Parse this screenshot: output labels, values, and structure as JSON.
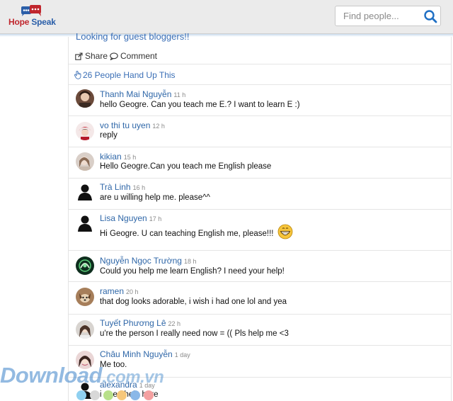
{
  "header": {
    "logo": {
      "hope": "Hope",
      "speak": "Speak"
    },
    "search": {
      "placeholder": "Find people..."
    }
  },
  "post": {
    "clipped_title": "Looking for guest bloggers!!",
    "actions": {
      "share": "Share",
      "comment": "Comment"
    },
    "hand_up": "26 People Hand Up This"
  },
  "comments": [
    {
      "author": "Thanh Mai Nguyễn",
      "time": "11 h",
      "text": "hello Geogre. Can you teach me E.? I want to learn E :)",
      "avatar": "photo-dark"
    },
    {
      "author": "vo thi tu uyen",
      "time": "12 h",
      "text": "reply",
      "avatar": "photo-red"
    },
    {
      "author": "kikian",
      "time": "15 h",
      "text": "Hello Geogre.Can you teach me English please",
      "avatar": "photo-light"
    },
    {
      "author": "Trà Linh",
      "time": "16 h",
      "text": "are u willing help me. please^^",
      "avatar": "silhouette"
    },
    {
      "author": "Lisa Nguyen",
      "time": "17 h",
      "text": "Hi Geogre. U can teaching English me, please!!!",
      "avatar": "silhouette",
      "emoji": "grin-emoji"
    },
    {
      "author": "Nguyễn Ngọc Trường",
      "time": "18 h",
      "text": "Could you help me learn English? I need your help!",
      "avatar": "photo-green"
    },
    {
      "author": "ramen",
      "time": "20 h",
      "text": "that dog looks adorable, i wish i had one lol and yea",
      "avatar": "photo-dog"
    },
    {
      "author": "Tuyết Phương Lê",
      "time": "22 h",
      "text": "u're the person I really need now = (( Pls help me <3",
      "avatar": "photo-girl"
    },
    {
      "author": "Châu Minh Nguyễn",
      "time": "1 day",
      "text": "Me too.",
      "avatar": "photo-pink"
    },
    {
      "author": "alexandra",
      "time": "1 day",
      "text": "i need help here",
      "avatar": "silhouette"
    }
  ],
  "watermark": {
    "main": "Download",
    "domain": ".com.vn"
  },
  "colors": {
    "link": "#2f67a8",
    "accent": "#3b6fb6",
    "logo_red": "#c0262d",
    "logo_blue": "#2a5ea8"
  }
}
